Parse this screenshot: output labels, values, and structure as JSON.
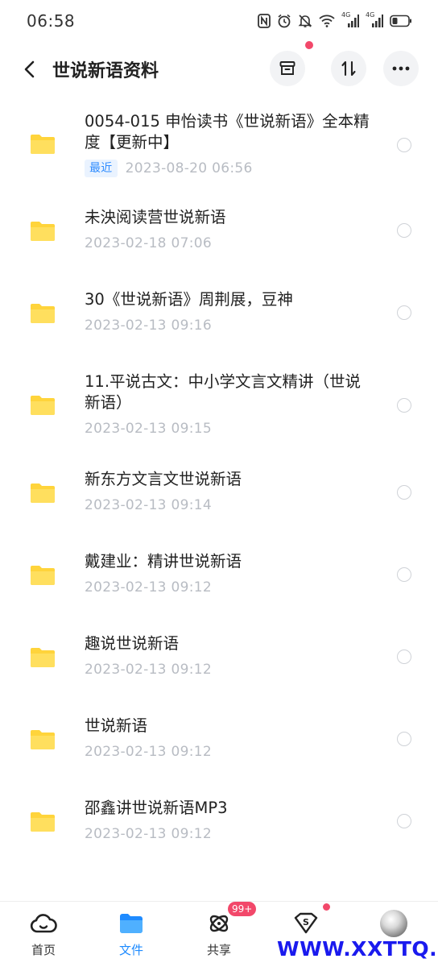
{
  "status_bar": {
    "time": "06:58",
    "icons": [
      "nfc-icon",
      "alarm-icon",
      "mute-icon",
      "wifi-icon",
      "signal-4g-icon",
      "signal-4g-icon",
      "battery-icon"
    ],
    "network_label_1": "4G",
    "network_label_2": "4G"
  },
  "header": {
    "title": "世说新语资料",
    "actions": [
      "archive-icon",
      "sort-icon",
      "more-icon"
    ]
  },
  "files": [
    {
      "name": "0054-015 申怡读书《世说新语》全本精度【更新中】",
      "badge": "最近",
      "time": "2023-08-20  06:56"
    },
    {
      "name": "未泱阅读营世说新语",
      "badge": "",
      "time": "2023-02-18  07:06"
    },
    {
      "name": "30《世说新语》周荆展，豆神",
      "badge": "",
      "time": "2023-02-13  09:16"
    },
    {
      "name": "11.平说古文：中小学文言文精讲（世说新语）",
      "badge": "",
      "time": "2023-02-13  09:15"
    },
    {
      "name": "新东方文言文世说新语",
      "badge": "",
      "time": "2023-02-13  09:14"
    },
    {
      "name": "戴建业：精讲世说新语",
      "badge": "",
      "time": "2023-02-13  09:12"
    },
    {
      "name": "趣说世说新语",
      "badge": "",
      "time": "2023-02-13  09:12"
    },
    {
      "name": "世说新语",
      "badge": "",
      "time": "2023-02-13  09:12"
    },
    {
      "name": "邵鑫讲世说新语MP3",
      "badge": "",
      "time": "2023-02-13  09:12"
    }
  ],
  "bottom_nav": {
    "items": [
      {
        "label": "首页",
        "icon": "cloud-home-icon"
      },
      {
        "label": "文件",
        "icon": "folder-icon",
        "active": true
      },
      {
        "label": "共享",
        "icon": "share-orbit-icon",
        "badge": "99+"
      },
      {
        "label": "",
        "icon": "wallet-s-icon"
      },
      {
        "label": "",
        "icon": "avatar"
      }
    ]
  },
  "watermark": "WWW.XXTTQ.COM",
  "colors": {
    "accent": "#1e8bff",
    "folder": "#ffd43b",
    "badge_red": "#f2486a",
    "meta_gray": "#b8bcc3"
  }
}
